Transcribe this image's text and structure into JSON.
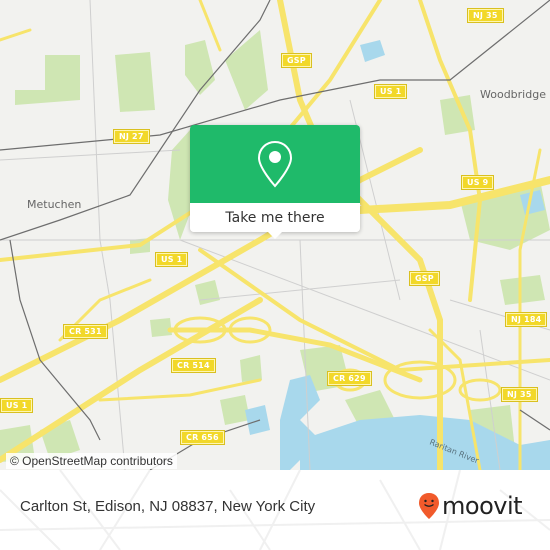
{
  "map": {
    "place_labels": {
      "metuchen": "Metuchen",
      "woodbridge": "Woodbridge",
      "raritan_river": "Raritan River"
    },
    "route_shields": [
      {
        "id": "nj27",
        "label": "NJ 27"
      },
      {
        "id": "gsp-north",
        "label": "GSP"
      },
      {
        "id": "nj35-north",
        "label": "NJ 35"
      },
      {
        "id": "us1-north",
        "label": "US 1"
      },
      {
        "id": "us9",
        "label": "US 9"
      },
      {
        "id": "us1-center",
        "label": "US 1"
      },
      {
        "id": "gsp-center",
        "label": "GSP"
      },
      {
        "id": "nj184",
        "label": "NJ 184"
      },
      {
        "id": "cr531",
        "label": "CR 531"
      },
      {
        "id": "cr514",
        "label": "CR 514"
      },
      {
        "id": "cr629",
        "label": "CR 629"
      },
      {
        "id": "us1-west",
        "label": "US 1"
      },
      {
        "id": "nj35-south",
        "label": "NJ 35"
      },
      {
        "id": "cr656",
        "label": "CR 656"
      }
    ],
    "attribution": "© OpenStreetMap contributors",
    "colors": {
      "land": "#f2f2ef",
      "park": "#cfe6b3",
      "water": "#a8d8ec",
      "highway": "#f7e46b",
      "rail": "#6e6e6e"
    }
  },
  "popup": {
    "icon": "location-pin-icon",
    "button_label": "Take me there",
    "color": "#1fba6a"
  },
  "footer": {
    "address": "Carlton St, Edison, NJ 08837, New York City",
    "brand_name": "moovit",
    "brand_color": "#f15a2b"
  }
}
